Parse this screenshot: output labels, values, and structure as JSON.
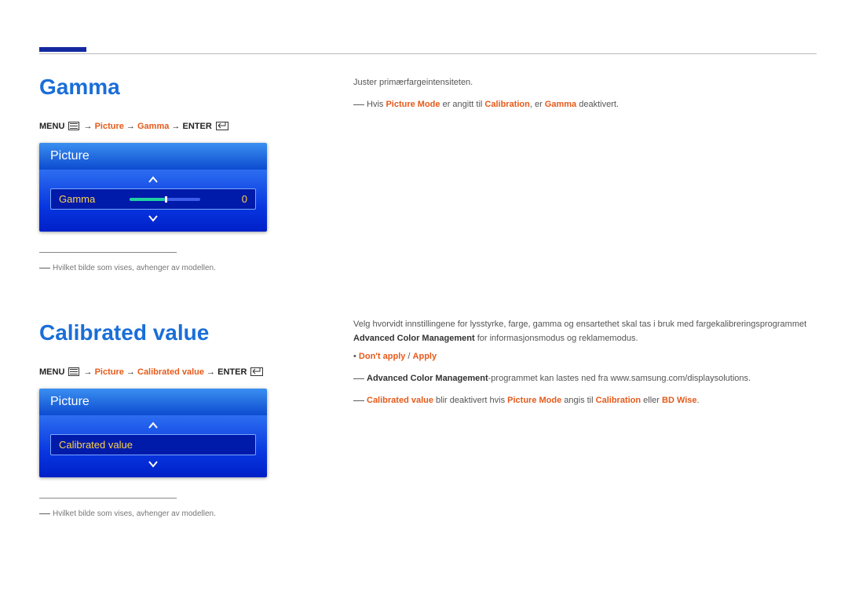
{
  "sectionGamma": {
    "title": "Gamma",
    "bc": {
      "menu": "MENU ",
      "arrow": " → ",
      "p1": "Picture",
      "p2": "Gamma",
      "enter": "ENTER "
    },
    "osd": {
      "header": "Picture",
      "label": "Gamma",
      "value": "0"
    },
    "footnote": "Hvilket bilde som vises, avhenger av modellen.",
    "right": {
      "l1": "Juster primærfargeintensiteten.",
      "l2a": "Hvis ",
      "l2b": "Picture Mode",
      "l2c": " er angitt til ",
      "l2d": "Calibration",
      "l2e": ", er ",
      "l2f": "Gamma",
      "l2g": " deaktivert."
    }
  },
  "sectionCal": {
    "title": "Calibrated value",
    "bc": {
      "menu": "MENU ",
      "arrow": " → ",
      "p1": "Picture",
      "p2": "Calibrated value",
      "enter": "ENTER "
    },
    "osd": {
      "header": "Picture",
      "label": "Calibrated value"
    },
    "footnote": "Hvilket bilde som vises, avhenger av modellen.",
    "right": {
      "l1a": "Velg hvorvidt innstillingene for lysstyrke, farge, gamma og ensartethet skal tas i bruk med fargekalibreringsprogrammet ",
      "l1b": "Advanced Color Management",
      "l1c": " for informasjonsmodus og reklamemodus.",
      "opt1": "Don't apply",
      "slash": " / ",
      "opt2": "Apply",
      "l2a": "Advanced Color Management",
      "l2b": "-programmet kan lastes ned fra www.samsung.com/displaysolutions.",
      "l3a": "Calibrated value",
      "l3b": " blir deaktivert hvis ",
      "l3c": "Picture Mode",
      "l3d": " angis til ",
      "l3e": "Calibration",
      "l3f": " eller ",
      "l3g": "BD Wise",
      "l3h": "."
    }
  }
}
